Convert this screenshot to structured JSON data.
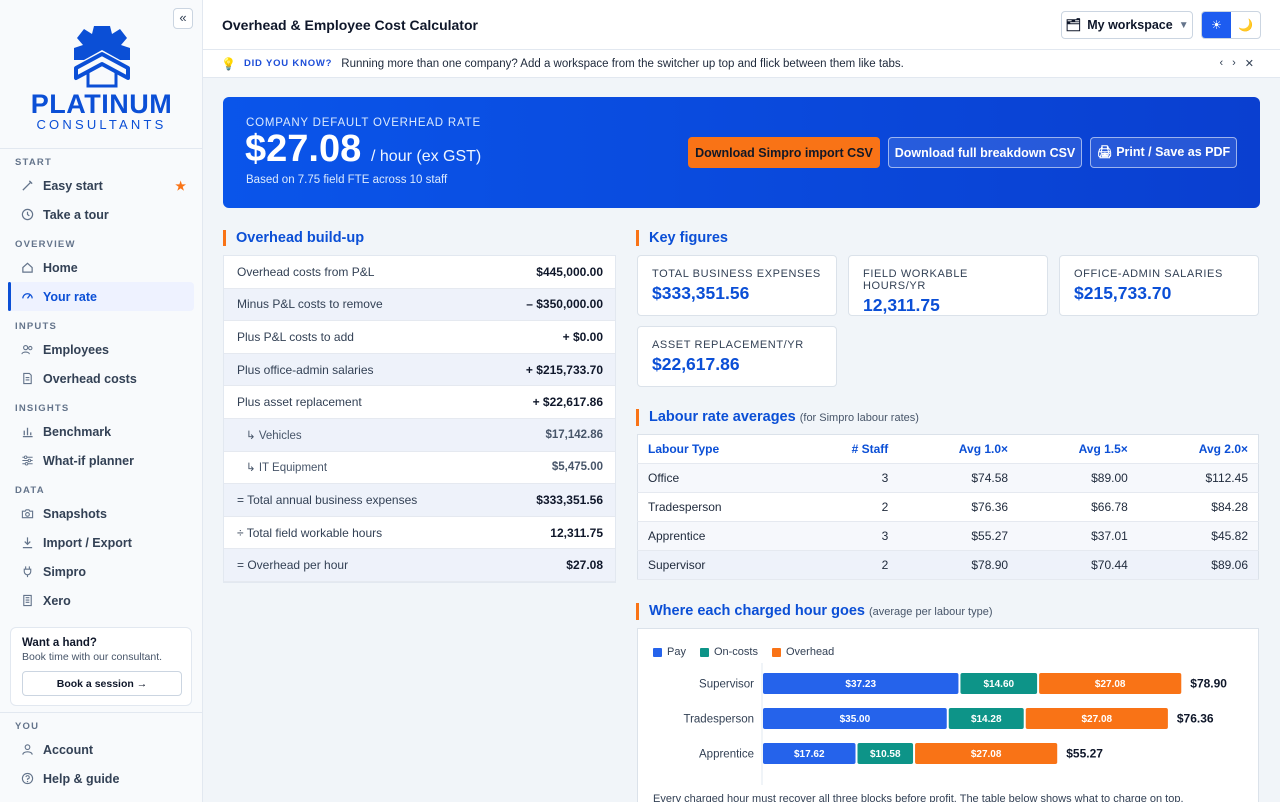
{
  "app": {
    "title": "Overhead & Employee Cost Calculator"
  },
  "brand": {
    "name": "PLATINUM",
    "sub": "CONSULTANTS",
    "color": "#0b4fd6"
  },
  "sidebar": {
    "collapse_label": "«",
    "sections": {
      "start": "START",
      "overview": "OVERVIEW",
      "inputs": "INPUTS",
      "insights": "INSIGHTS",
      "data": "DATA",
      "you": "YOU"
    },
    "items": {
      "easy_start": "Easy start",
      "take_tour": "Take a tour",
      "home": "Home",
      "your_rate": "Your rate",
      "employees": "Employees",
      "overhead_costs": "Overhead costs",
      "benchmark": "Benchmark",
      "whatif": "What-if planner",
      "snapshots": "Snapshots",
      "import_export": "Import / Export",
      "simpro": "Simpro",
      "xero": "Xero",
      "account": "Account",
      "help": "Help & guide"
    },
    "help_card": {
      "title": "Want a hand?",
      "subtitle": "Book time with our consultant.",
      "button": "Book a session →"
    }
  },
  "header": {
    "workspace": "My workspace",
    "theme_light": "☀",
    "theme_dark": "🌙"
  },
  "tip": {
    "label": "DID YOU KNOW?",
    "text": "Running more than one company? Add a workspace from the switcher up top and flick between them like tabs.",
    "prev": "‹",
    "next": "›",
    "close": "✕"
  },
  "hero": {
    "label": "COMPANY DEFAULT OVERHEAD RATE",
    "rate": "$27.08",
    "unit": "/ hour (ex GST)",
    "sub": "Based on 7.75 field FTE across 10 staff",
    "btn_simpro": "Download Simpro import CSV",
    "btn_breakdown": "Download full breakdown CSV",
    "btn_print": "🖨 Print / Save as PDF"
  },
  "buildup": {
    "title": "Overhead build-up",
    "rows": [
      {
        "label": "Overhead costs from P&L",
        "value": "$445,000.00"
      },
      {
        "label": "Minus P&L costs to remove",
        "value": "– $350,000.00"
      },
      {
        "label": "Plus P&L costs to add",
        "value": "+ $0.00"
      },
      {
        "label": "Plus office-admin salaries",
        "value": "+ $215,733.70"
      },
      {
        "label": "Plus asset replacement",
        "value": "+ $22,617.86"
      },
      {
        "label": "↳ Vehicles",
        "value": "$17,142.86"
      },
      {
        "label": "↳ IT Equipment",
        "value": "$5,475.00"
      },
      {
        "label": "= Total annual business expenses",
        "value": "$333,351.56"
      },
      {
        "label": "÷ Total field workable hours",
        "value": "12,311.75"
      },
      {
        "label": "= Overhead per hour",
        "value": "$27.08"
      }
    ]
  },
  "key_figures": {
    "title": "Key figures",
    "cards": [
      {
        "label": "TOTAL BUSINESS EXPENSES",
        "value": "$333,351.56"
      },
      {
        "label": "FIELD WORKABLE HOURS/YR",
        "value": "12,311.75"
      },
      {
        "label": "OFFICE-ADMIN SALARIES",
        "value": "$215,733.70"
      },
      {
        "label": "ASSET REPLACEMENT/YR",
        "value": "$22,617.86"
      }
    ]
  },
  "labour": {
    "title": "Labour rate averages",
    "subtitle": "(for Simpro labour rates)",
    "headers": [
      "Labour Type",
      "# Staff",
      "Avg 1.0×",
      "Avg 1.5×",
      "Avg 2.0×"
    ],
    "rows": [
      [
        "Office",
        "3",
        "$74.58",
        "$89.00",
        "$112.45"
      ],
      [
        "Tradesperson",
        "2",
        "$76.36",
        "$66.78",
        "$84.28"
      ],
      [
        "Apprentice",
        "3",
        "$55.27",
        "$37.01",
        "$45.82"
      ],
      [
        "Supervisor",
        "2",
        "$78.90",
        "$70.44",
        "$89.06"
      ]
    ]
  },
  "hours": {
    "title": "Where each charged hour goes",
    "subtitle": "(average per labour type)",
    "footnote": "Every charged hour must recover all three blocks before profit. The table below shows what to charge on top."
  },
  "chart_data": {
    "type": "bar",
    "orientation": "horizontal",
    "stacked": true,
    "categories": [
      "Supervisor",
      "Tradesperson",
      "Apprentice"
    ],
    "series": [
      {
        "name": "Pay",
        "values": [
          37.23,
          35.0,
          17.62
        ],
        "color": "#2563eb"
      },
      {
        "name": "On-costs",
        "values": [
          14.6,
          14.28,
          10.58
        ],
        "color": "#0d9488"
      },
      {
        "name": "Overhead",
        "values": [
          27.08,
          27.08,
          27.08
        ],
        "color": "#f97316"
      }
    ],
    "totals": [
      "$78.90",
      "$76.36",
      "$55.27"
    ],
    "legend": "top-left"
  }
}
